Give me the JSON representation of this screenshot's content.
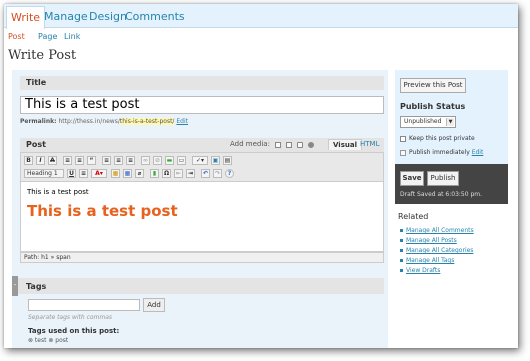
{
  "tabs": {
    "write": "Write",
    "manage": "Manage",
    "design": "Design",
    "comments": "Comments"
  },
  "subtabs": {
    "post": "Post",
    "page": "Page",
    "link": "Link"
  },
  "page_title": "Write Post",
  "title_box": {
    "heading": "Title",
    "value": "This is a test post",
    "permalink_label": "Permalink:",
    "permalink_base": "http://thess.in/news/",
    "permalink_slug": "this-is-a-test-post/",
    "permalink_edit": "Edit"
  },
  "post_box": {
    "heading": "Post",
    "add_media": "Add media:",
    "tab_visual": "Visual",
    "tab_html": "HTML",
    "format_select": "Heading 1",
    "content_small": "This is a test post",
    "content_heading": "This is a test post",
    "path": "Path: h1 » span"
  },
  "tags_box": {
    "heading": "Tags",
    "input_value": "",
    "add_label": "Add",
    "hint": "Separate tags with commas",
    "used_label": "Tags used on this post:",
    "used_tags": "⊗ test   ⊗ post"
  },
  "sidebar": {
    "preview_label": "Preview this Post",
    "publish_status_title": "Publish Status",
    "status_value": "Unpublished",
    "private_label": "Keep this post private",
    "publish_immediately": "Publish immediately",
    "publish_edit": "Edit",
    "save_label": "Save",
    "publish_label": "Publish",
    "draft_saved": "Draft Saved at 6:03:50 pm.",
    "related_title": "Related",
    "related_links": [
      "Manage All Comments",
      "Manage All Posts",
      "Manage All Categories",
      "Manage All Tags",
      "View Drafts"
    ]
  },
  "colors": {
    "accent_orange": "#d54e21",
    "link_blue": "#2583ad",
    "heading_orange": "#e8611d",
    "tab_bar_bg": "#e4f2fd",
    "dark_panel": "#444444"
  }
}
